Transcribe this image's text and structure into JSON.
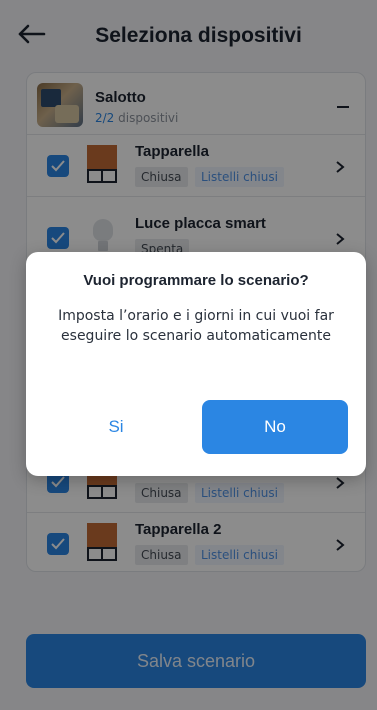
{
  "header": {
    "back_icon": "arrow-left-icon",
    "title": "Seleziona dispositivi"
  },
  "room": {
    "name": "Salotto",
    "count_selected": "2/2",
    "count_suffix": " dispositivi"
  },
  "devices": [
    {
      "name": "Tapparella",
      "icon": "shutter-icon",
      "state": "Chiusa",
      "detail": "Listelli chiusi",
      "checked": true
    },
    {
      "name": "Luce placca smart",
      "icon": "bulb-icon",
      "state": "Spenta",
      "detail": "",
      "checked": true
    },
    {
      "name": "",
      "icon": "shutter-icon",
      "state": "Chiusa",
      "detail": "Listelli chiusi",
      "checked": true
    },
    {
      "name": "Tapparella 2",
      "icon": "shutter-icon",
      "state": "Chiusa",
      "detail": "Listelli chiusi",
      "checked": true
    }
  ],
  "save_button": "Salva scenario",
  "dialog": {
    "title": "Vuoi programmare lo scenario?",
    "body": "Imposta l’orario e i giorni in cui vuoi far eseguire lo scenario automaticamente",
    "yes_label": "Si",
    "no_label": "No"
  },
  "colors": {
    "accent": "#2b86e3",
    "shutter": "#c26a36",
    "overlay": "rgba(0,0,0,0.45)"
  }
}
